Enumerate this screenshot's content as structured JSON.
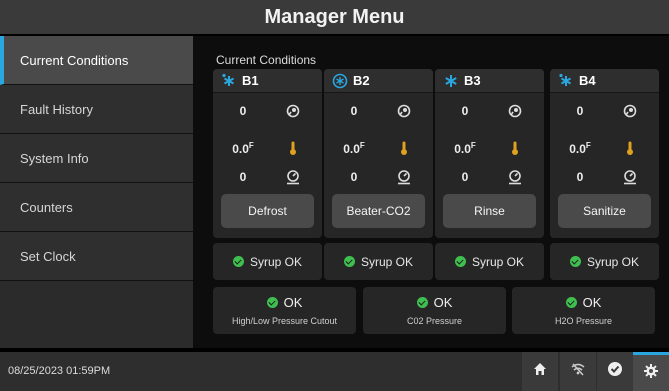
{
  "header": {
    "title": "Manager Menu"
  },
  "sidebar": {
    "items": [
      {
        "label": "Current Conditions",
        "active": true
      },
      {
        "label": "Fault History"
      },
      {
        "label": "System Info"
      },
      {
        "label": "Counters"
      },
      {
        "label": "Set Clock"
      }
    ]
  },
  "main": {
    "section_title": "Current Conditions",
    "bays": [
      {
        "name": "B1",
        "icon": "snowflake-drip-icon",
        "rows": [
          "0",
          "0.0",
          "0"
        ],
        "unit_mark": "F",
        "button": "Defrost"
      },
      {
        "name": "B2",
        "icon": "beater-icon",
        "rows": [
          "0",
          "0.0",
          "0"
        ],
        "unit_mark": "F",
        "button": "Beater-CO2"
      },
      {
        "name": "B3",
        "icon": "snowflake-icon",
        "rows": [
          "0",
          "0.0",
          "0"
        ],
        "unit_mark": "F",
        "button": "Rinse"
      },
      {
        "name": "B4",
        "icon": "snowflake-drip-icon",
        "rows": [
          "0",
          "0.0",
          "0"
        ],
        "unit_mark": "F",
        "button": "Sanitize"
      }
    ],
    "syrup": [
      "Syrup OK",
      "Syrup OK",
      "Syrup OK",
      "Syrup OK"
    ],
    "pressures": [
      {
        "status": "OK",
        "label": "High/Low Pressure Cutout"
      },
      {
        "status": "OK",
        "label": "C02 Pressure"
      },
      {
        "status": "OK",
        "label": "H2O Pressure"
      }
    ]
  },
  "footer": {
    "datetime": "08/25/2023 01:59PM"
  },
  "colors": {
    "accent": "#2aa7e0",
    "ok": "#3fbf4f",
    "temp": "#e0a020"
  }
}
